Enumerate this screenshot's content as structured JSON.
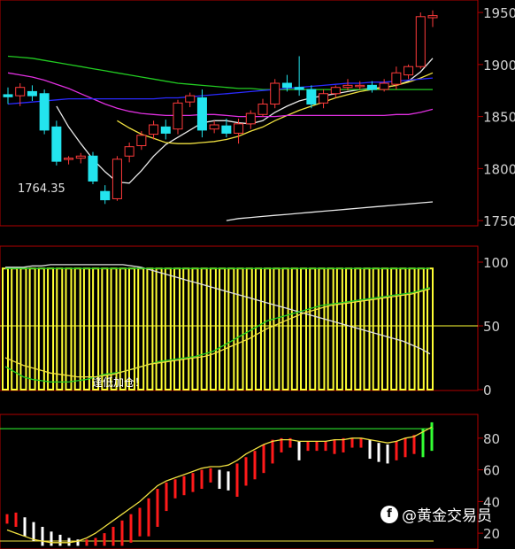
{
  "watermark": {
    "text": "@黄金交易员",
    "icon": "toutiao-logo-icon"
  },
  "colors": {
    "background": "#000000",
    "frame": "#b00000",
    "up": "#ff3b3b",
    "down": "#23e4ee",
    "ma_white": "#e8e8e8",
    "ma_yellow": "#f0e040",
    "ma_magenta": "#e030e0",
    "ma_green": "#22cc22",
    "ma_blue": "#2a2aff",
    "osc_bar": "#ffff33",
    "osc_white": "#dddddd",
    "osc_green": "#22cc22",
    "osc_yellow": "#f0e040",
    "ind3_up": "#ff1a1a",
    "ind3_down": "#ffffff",
    "ind3_green": "#33ff33",
    "ind3_yellow": "#f0e040",
    "axis_text": "#d0d0d0"
  },
  "chart_data": [
    {
      "type": "candlestick",
      "panel": "price",
      "ylim": [
        1745,
        1962
      ],
      "yticks": [
        1750,
        1800,
        1850,
        1900,
        1950
      ],
      "annotation": "1764.35",
      "candles": [
        {
          "o": 1871,
          "h": 1878,
          "l": 1862,
          "c": 1869
        },
        {
          "o": 1870,
          "h": 1882,
          "l": 1860,
          "c": 1878
        },
        {
          "o": 1874,
          "h": 1880,
          "l": 1865,
          "c": 1870
        },
        {
          "o": 1872,
          "h": 1876,
          "l": 1833,
          "c": 1837
        },
        {
          "o": 1840,
          "h": 1846,
          "l": 1803,
          "c": 1807
        },
        {
          "o": 1809,
          "h": 1812,
          "l": 1804,
          "c": 1810
        },
        {
          "o": 1810,
          "h": 1815,
          "l": 1805,
          "c": 1812
        },
        {
          "o": 1812,
          "h": 1816,
          "l": 1785,
          "c": 1788
        },
        {
          "o": 1778,
          "h": 1784,
          "l": 1766,
          "c": 1770
        },
        {
          "o": 1771,
          "h": 1812,
          "l": 1769,
          "c": 1809
        },
        {
          "o": 1812,
          "h": 1825,
          "l": 1806,
          "c": 1821
        },
        {
          "o": 1822,
          "h": 1836,
          "l": 1818,
          "c": 1832
        },
        {
          "o": 1833,
          "h": 1846,
          "l": 1828,
          "c": 1842
        },
        {
          "o": 1840,
          "h": 1847,
          "l": 1828,
          "c": 1834
        },
        {
          "o": 1838,
          "h": 1866,
          "l": 1833,
          "c": 1863
        },
        {
          "o": 1864,
          "h": 1873,
          "l": 1859,
          "c": 1870
        },
        {
          "o": 1868,
          "h": 1876,
          "l": 1830,
          "c": 1837
        },
        {
          "o": 1838,
          "h": 1846,
          "l": 1834,
          "c": 1842
        },
        {
          "o": 1841,
          "h": 1848,
          "l": 1830,
          "c": 1834
        },
        {
          "o": 1834,
          "h": 1848,
          "l": 1824,
          "c": 1843
        },
        {
          "o": 1843,
          "h": 1856,
          "l": 1838,
          "c": 1853
        },
        {
          "o": 1852,
          "h": 1867,
          "l": 1850,
          "c": 1862
        },
        {
          "o": 1862,
          "h": 1886,
          "l": 1858,
          "c": 1882
        },
        {
          "o": 1882,
          "h": 1890,
          "l": 1874,
          "c": 1878
        },
        {
          "o": 1878,
          "h": 1908,
          "l": 1870,
          "c": 1876
        },
        {
          "o": 1876,
          "h": 1880,
          "l": 1858,
          "c": 1862
        },
        {
          "o": 1863,
          "h": 1876,
          "l": 1858,
          "c": 1872
        },
        {
          "o": 1872,
          "h": 1880,
          "l": 1868,
          "c": 1878
        },
        {
          "o": 1878,
          "h": 1886,
          "l": 1875,
          "c": 1880
        },
        {
          "o": 1880,
          "h": 1884,
          "l": 1876,
          "c": 1880
        },
        {
          "o": 1880,
          "h": 1884,
          "l": 1873,
          "c": 1876
        },
        {
          "o": 1876,
          "h": 1886,
          "l": 1874,
          "c": 1882
        },
        {
          "o": 1881,
          "h": 1898,
          "l": 1876,
          "c": 1892
        },
        {
          "o": 1890,
          "h": 1900,
          "l": 1886,
          "c": 1898
        },
        {
          "o": 1898,
          "h": 1950,
          "l": 1896,
          "c": 1946
        },
        {
          "o": 1945,
          "h": 1952,
          "l": 1936,
          "c": 1947
        }
      ],
      "series": [
        {
          "name": "",
          "color": "ma_white",
          "values": [
            null,
            null,
            null,
            null,
            1860,
            1840,
            1824,
            1809,
            1797,
            1787,
            1786,
            1798,
            1812,
            1823,
            1830,
            1837,
            1844,
            1846,
            1846,
            1844,
            1843,
            1846,
            1854,
            1860,
            1865,
            1868,
            1870,
            1872,
            1874,
            1876,
            1877,
            1878,
            1880,
            1884,
            1893,
            1906
          ]
        },
        {
          "name": "",
          "color": "ma_yellow",
          "values": [
            null,
            null,
            null,
            null,
            null,
            null,
            null,
            null,
            null,
            1846,
            1839,
            1833,
            1829,
            1825,
            1824,
            1824,
            1825,
            1826,
            1828,
            1831,
            1836,
            1840,
            1846,
            1851,
            1856,
            1860,
            1864,
            1868,
            1871,
            1874,
            1876,
            1878,
            1880,
            1883,
            1887,
            1892
          ]
        },
        {
          "name": "",
          "color": "ma_magenta",
          "values": [
            1892,
            1890,
            1888,
            1885,
            1881,
            1877,
            1872,
            1867,
            1862,
            1858,
            1855,
            1853,
            1852,
            1851,
            1851,
            1851,
            1852,
            1852,
            1851,
            1850,
            1850,
            1850,
            1850,
            1851,
            1851,
            1851,
            1851,
            1851,
            1851,
            1851,
            1851,
            1851,
            1852,
            1852,
            1854,
            1857
          ]
        },
        {
          "name": "",
          "color": "ma_green",
          "values": [
            1908,
            1907,
            1906,
            1904,
            1902,
            1900,
            1898,
            1896,
            1894,
            1892,
            1890,
            1888,
            1886,
            1884,
            1882,
            1881,
            1880,
            1879,
            1878,
            1877,
            1877,
            1876,
            1876,
            1876,
            1876,
            1876,
            1876,
            1876,
            1876,
            1876,
            1876,
            1876,
            1876,
            1876,
            1876,
            1876
          ]
        },
        {
          "name": "",
          "color": "ma_blue",
          "values": [
            1862,
            1863,
            1864,
            1865,
            1866,
            1867,
            1867,
            1867,
            1867,
            1867,
            1867,
            1867,
            1867,
            1868,
            1868,
            1869,
            1870,
            1871,
            1872,
            1873,
            1874,
            1875,
            1876,
            1877,
            1878,
            1879,
            1880,
            1881,
            1882,
            1882,
            1883,
            1883,
            1884,
            1885,
            1886,
            1887
          ]
        },
        {
          "name": "",
          "color": "ma_white",
          "values": [
            null,
            null,
            null,
            null,
            null,
            null,
            null,
            null,
            null,
            null,
            null,
            null,
            null,
            null,
            null,
            null,
            null,
            null,
            1750,
            1752,
            1753,
            1754,
            1755,
            1756,
            1757,
            1758,
            1759,
            1760,
            1761,
            1762,
            1763,
            1764,
            1765,
            1766,
            1767,
            1768
          ]
        }
      ]
    },
    {
      "type": "bar",
      "panel": "oscillator",
      "ylim": [
        0,
        100
      ],
      "yticks": [
        0,
        50,
        100
      ],
      "text_label": "逢低加仓！",
      "values": [
        95,
        95,
        95,
        95,
        95,
        95,
        95,
        95,
        95,
        95,
        95,
        95,
        95,
        95,
        95,
        95,
        95,
        95,
        95,
        95,
        95,
        95,
        95,
        95,
        95,
        95,
        95,
        95,
        95,
        95,
        95,
        95,
        95,
        95,
        95,
        95,
        95,
        95,
        95,
        95,
        95,
        95,
        95,
        95,
        95,
        95,
        95,
        95
      ],
      "series": [
        {
          "name": "",
          "color": "osc_white",
          "values": [
            96,
            96,
            96,
            97,
            97,
            98,
            98,
            98,
            98,
            98,
            98,
            98,
            98,
            98,
            97,
            96,
            94,
            92,
            90,
            88,
            86,
            84,
            82,
            80,
            78,
            76,
            74,
            72,
            70,
            68,
            66,
            64,
            62,
            60,
            58,
            56,
            54,
            52,
            50,
            48,
            46,
            44,
            42,
            40,
            38,
            35,
            32,
            28
          ]
        },
        {
          "name": "",
          "color": "osc_green",
          "values": [
            18,
            14,
            10,
            8,
            7,
            6,
            6,
            6,
            7,
            8,
            10,
            12,
            13,
            14,
            16,
            18,
            20,
            22,
            23,
            24,
            25,
            26,
            28,
            30,
            34,
            38,
            42,
            46,
            50,
            54,
            56,
            58,
            60,
            62,
            64,
            66,
            67,
            68,
            69,
            70,
            71,
            72,
            73,
            74,
            75,
            76,
            78,
            80
          ]
        },
        {
          "name": "",
          "color": "osc_yellow",
          "values": [
            25,
            22,
            19,
            17,
            15,
            13,
            12,
            11,
            10,
            10,
            10,
            11,
            12,
            14,
            16,
            18,
            20,
            21,
            22,
            23,
            24,
            25,
            26,
            28,
            31,
            34,
            37,
            40,
            44,
            48,
            51,
            54,
            57,
            60,
            62,
            64,
            66,
            67,
            68,
            69,
            70,
            71,
            72,
            73,
            74,
            75,
            77,
            79
          ]
        },
        {
          "name": "",
          "color": "osc_green",
          "values": [
            95,
            95,
            95,
            95,
            95,
            95,
            95,
            95,
            95,
            95,
            95,
            95,
            95,
            95,
            95,
            95,
            95,
            95,
            95,
            95,
            95,
            95,
            95,
            95,
            95,
            95,
            95,
            95,
            95,
            95,
            95,
            95,
            95,
            95,
            95,
            95,
            95,
            95,
            95,
            95,
            95,
            95,
            95,
            95,
            95,
            95,
            95,
            95
          ]
        }
      ]
    },
    {
      "type": "bar",
      "panel": "indicator",
      "ylim": [
        10,
        95
      ],
      "yticks": [
        20,
        40,
        60,
        80
      ],
      "values": [
        32,
        33,
        30,
        27,
        24,
        21,
        19,
        17,
        16,
        16,
        17,
        20,
        24,
        28,
        32,
        36,
        42,
        48,
        52,
        54,
        56,
        58,
        60,
        61,
        60,
        59,
        64,
        68,
        72,
        76,
        79,
        80,
        80,
        78,
        78,
        78,
        78,
        79,
        80,
        80,
        80,
        79,
        77,
        76,
        78,
        80,
        82,
        86,
        90
      ],
      "reference": {
        "upper": 86,
        "lower": 15
      },
      "series": [
        {
          "name": "",
          "color": "ind3_yellow",
          "values": [
            22,
            20,
            18,
            16,
            15,
            14,
            14,
            14,
            15,
            17,
            20,
            24,
            28,
            32,
            36,
            40,
            45,
            50,
            53,
            55,
            57,
            59,
            61,
            62,
            62,
            63,
            66,
            70,
            73,
            76,
            78,
            79,
            79,
            78,
            78,
            78,
            78,
            79,
            79,
            80,
            80,
            79,
            78,
            77,
            78,
            80,
            81,
            84,
            87
          ]
        }
      ]
    }
  ]
}
